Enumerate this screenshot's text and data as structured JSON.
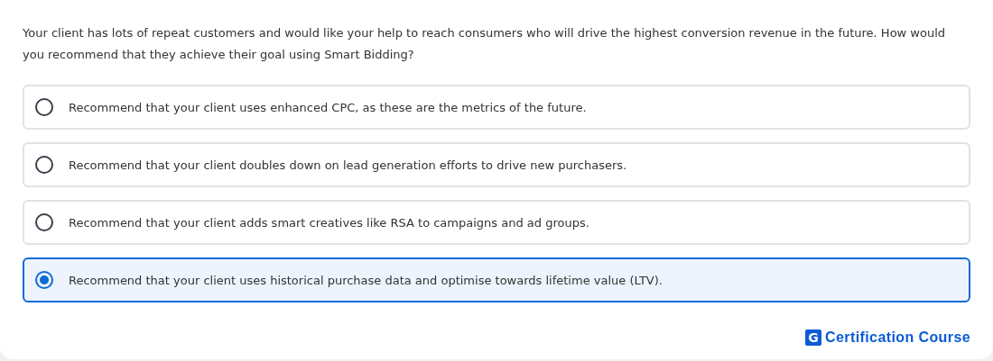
{
  "question": "Your client has lots of repeat customers and would like your help to reach consumers who will drive the highest conversion revenue in the future. How would you recommend that they achieve their goal using Smart Bidding?",
  "options": [
    {
      "label": "Recommend that your client uses enhanced CPC, as these are the metrics of the future.",
      "selected": false
    },
    {
      "label": "Recommend that your client doubles down on lead generation efforts to drive new purchasers.",
      "selected": false
    },
    {
      "label": "Recommend that your client adds smart creatives like RSA to campaigns and ad groups.",
      "selected": false
    },
    {
      "label": "Recommend that your client uses historical purchase data and optimise towards lifetime value (LTV).",
      "selected": true
    }
  ],
  "brand": {
    "mark": "G",
    "name": "Certification Course"
  }
}
